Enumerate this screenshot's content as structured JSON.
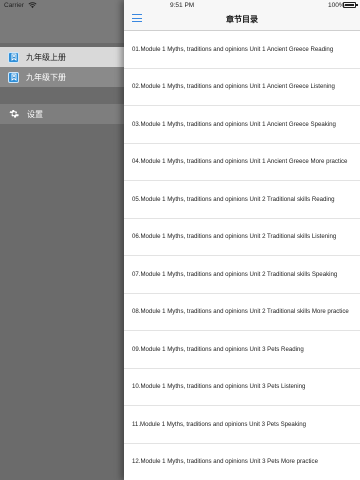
{
  "status_bar": {
    "carrier": "Carrier",
    "time": "9:51 PM",
    "battery": "100%"
  },
  "drawer": {
    "items": [
      {
        "label": "九年级上册",
        "icon": "app-book-icon"
      },
      {
        "label": "九年级下册",
        "icon": "app-book-icon"
      }
    ],
    "settings": {
      "label": "设置",
      "icon": "gear-icon"
    }
  },
  "nav": {
    "title": "章节目录",
    "menu_icon": "hamburger-menu-icon"
  },
  "chapters": [
    "01.Module 1 Myths, traditions and opinions Unit 1 Ancient Greece Reading",
    "02.Module 1 Myths, traditions and opinions Unit 1 Ancient Greece Listening",
    "03.Module 1 Myths, traditions and opinions Unit 1 Ancient Greece Speaking",
    "04.Module 1 Myths, traditions and opinions Unit 1 Ancient Greece More practice",
    "05.Module 1 Myths, traditions and opinions Unit 2 Traditional skills Reading",
    "06.Module 1 Myths, traditions and opinions Unit 2 Traditional skills Listening",
    "07.Module 1 Myths, traditions and opinions Unit 2 Traditional skills Speaking",
    "08.Module 1 Myths, traditions and opinions Unit 2 Traditional skills More practice",
    "09.Module 1 Myths, traditions and opinions Unit 3 Pets Reading",
    "10.Module 1 Myths, traditions and opinions Unit 3 Pets Listening",
    "11.Module 1 Myths, traditions and opinions Unit 3 Pets Speaking",
    "12.Module 1 Myths, traditions and opinions Unit 3 Pets More practice"
  ]
}
